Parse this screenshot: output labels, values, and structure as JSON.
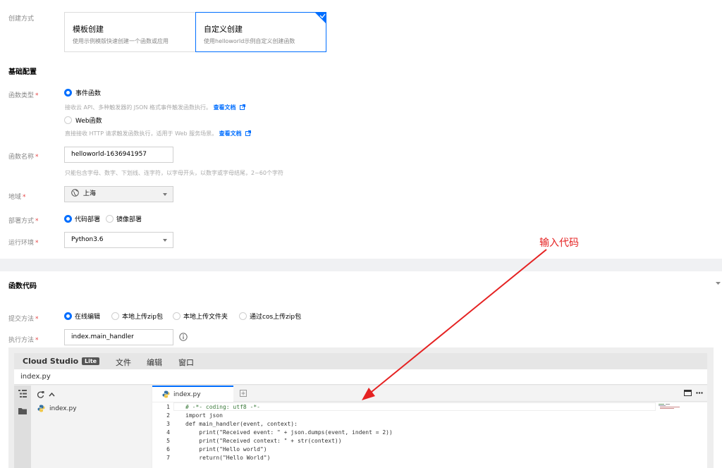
{
  "create_method": {
    "label": "创建方式",
    "options": [
      {
        "title": "模板创建",
        "desc": "使用示例模版快速创建一个函数或应用"
      },
      {
        "title": "自定义创建",
        "desc": "使用helloworld示例自定义创建函数"
      }
    ]
  },
  "basic": {
    "title": "基础配置",
    "func_type": {
      "label": "函数类型",
      "options": [
        {
          "text": "事件函数",
          "help": "接收云 API、多种触发器的 JSON 格式事件触发函数执行。",
          "link": "查看文档"
        },
        {
          "text": "Web函数",
          "help": "直接接收 HTTP 请求触发函数执行，适用于 Web 服务场景。",
          "link": "查看文档"
        }
      ]
    },
    "func_name": {
      "label": "函数名称",
      "value": "helloworld-1636941957",
      "help": "只能包含字母、数字、下划线、连字符，以字母开头，以数字或字母结尾，2~60个字符"
    },
    "region": {
      "label": "地域",
      "value": "上海"
    },
    "deploy": {
      "label": "部署方式",
      "options": [
        "代码部署",
        "镜像部署"
      ]
    },
    "runtime": {
      "label": "运行环境",
      "value": "Python3.6"
    }
  },
  "annotation": {
    "text": "输入代码",
    "color": "#e52222"
  },
  "code": {
    "title": "函数代码",
    "submit": {
      "label": "提交方法",
      "options": [
        "在线编辑",
        "本地上传zip包",
        "本地上传文件夹",
        "通过cos上传zip包"
      ]
    },
    "handler": {
      "label": "执行方法",
      "value": "index.main_handler"
    }
  },
  "ide": {
    "brand": "Cloud Studio",
    "badge": "Lite",
    "menu": [
      "文件",
      "编辑",
      "窗口"
    ],
    "filepath": "index.py",
    "tree_file": "index.py",
    "tab": "index.py",
    "lines": [
      {
        "n": "1",
        "code": "# -*- coding: utf8 -*-"
      },
      {
        "n": "2",
        "code": "import json"
      },
      {
        "n": "3",
        "code": "def main_handler(event, context):"
      },
      {
        "n": "4",
        "code": "    print(\"Received event: \" + json.dumps(event, indent = 2))"
      },
      {
        "n": "5",
        "code": "    print(\"Received context: \" + str(context))"
      },
      {
        "n": "6",
        "code": "    print(\"Hello world\")"
      },
      {
        "n": "7",
        "code": "    return(\"Hello World\")"
      }
    ]
  },
  "colors": {
    "primary": "#006eff",
    "required": "#e54545"
  }
}
